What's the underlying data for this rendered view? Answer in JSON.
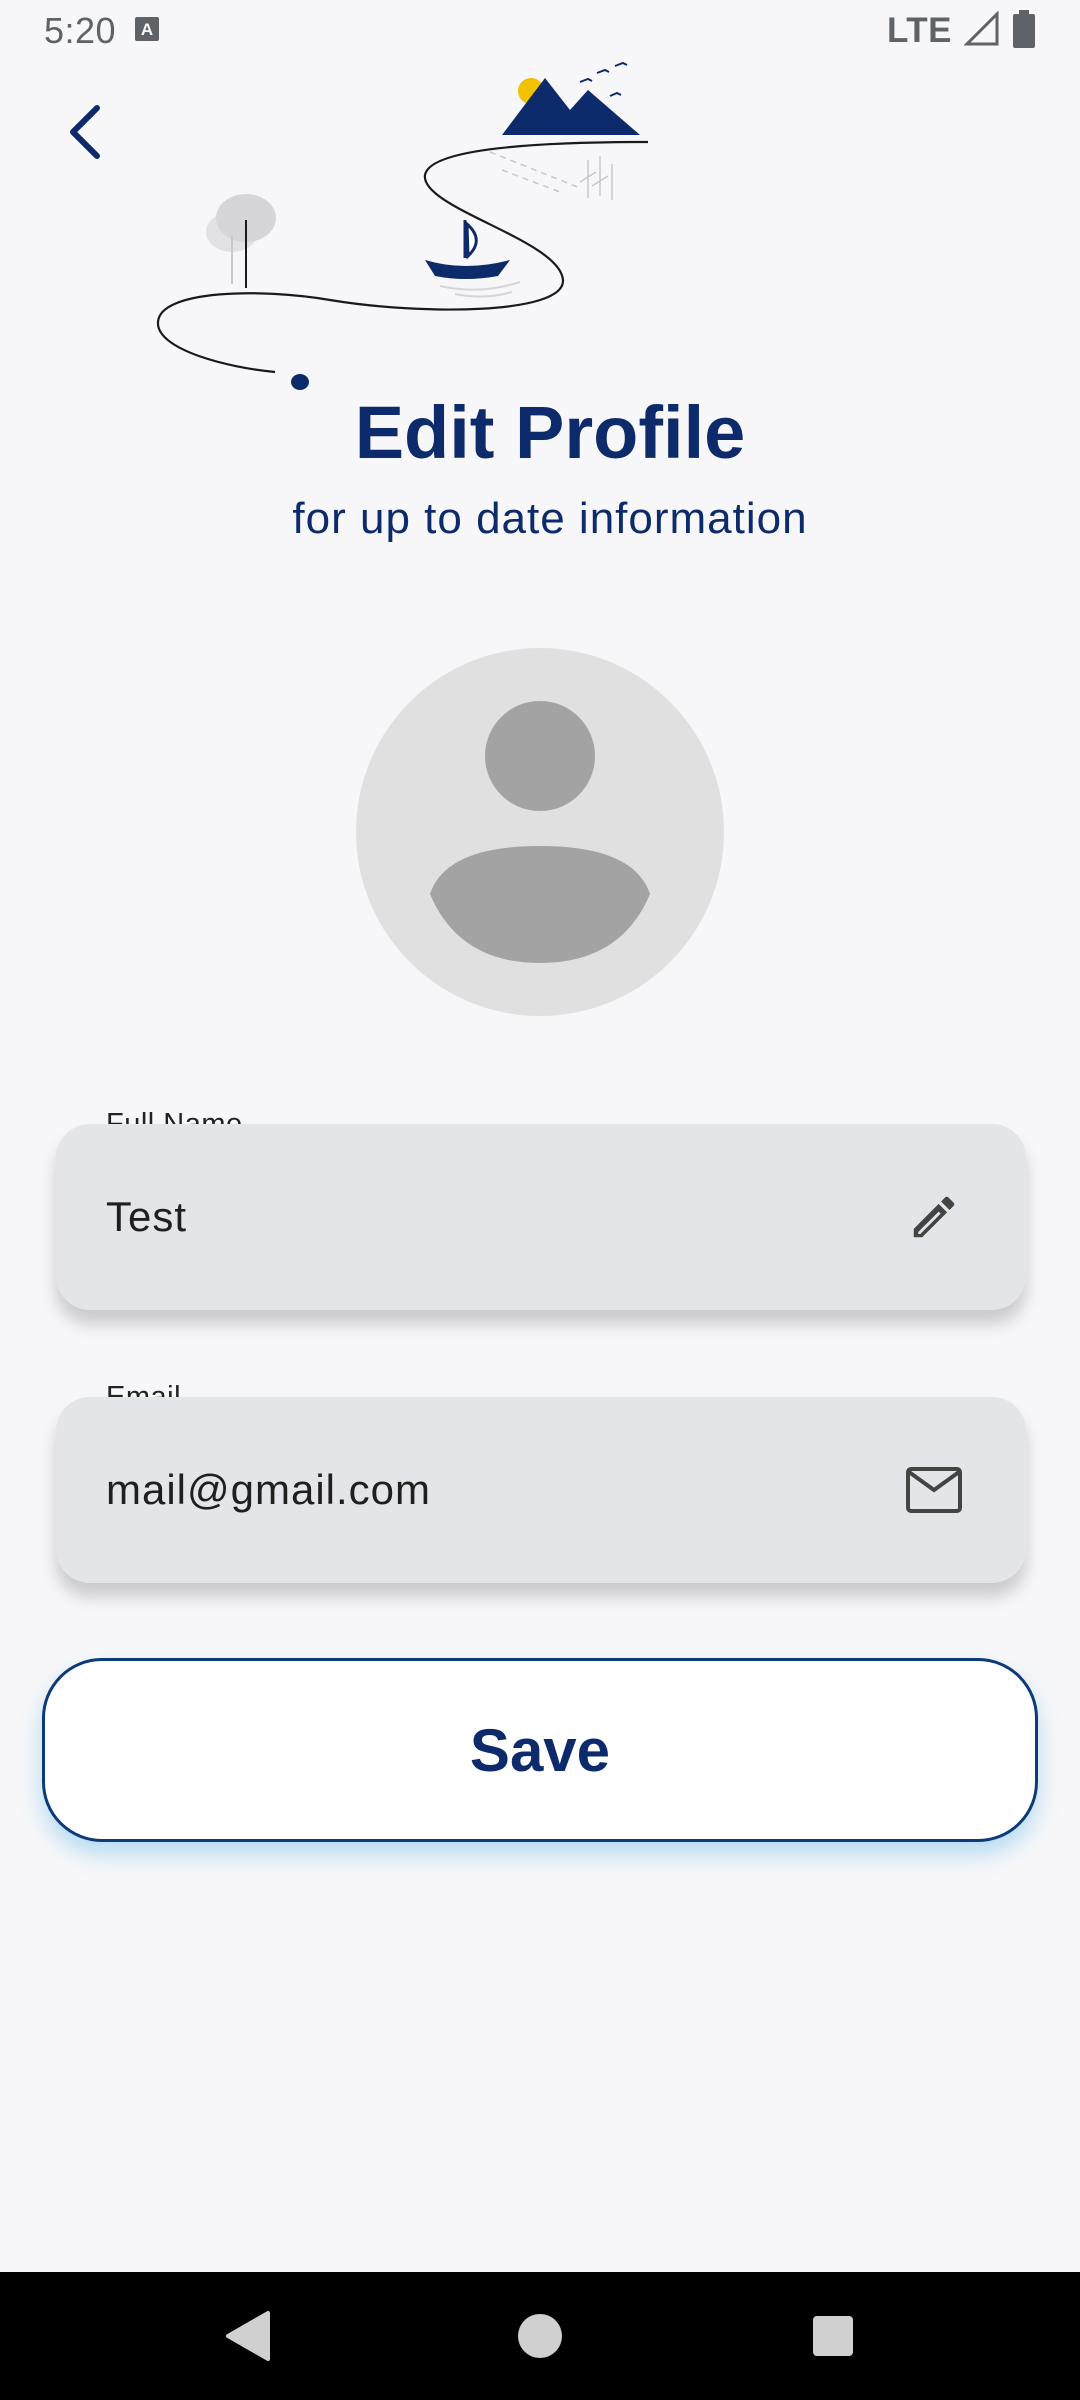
{
  "status_bar": {
    "time": "5:20",
    "network": "LTE",
    "icons": [
      "keyboard-icon",
      "signal-icon",
      "battery-icon"
    ]
  },
  "header": {
    "title": "Edit Profile",
    "subtitle": "for up to date information"
  },
  "form": {
    "full_name": {
      "label": "Full Name",
      "value": "Test",
      "icon": "pencil-icon"
    },
    "email": {
      "label": "Email",
      "value": "mail@gmail.com",
      "icon": "mail-icon"
    }
  },
  "actions": {
    "save_label": "Save"
  },
  "colors": {
    "primary": "#0d2b6b",
    "background": "#f7f7f9",
    "field_bg": "#e4e5e9",
    "accent_sun": "#f2c200"
  },
  "nav": {
    "icons": [
      "back-triangle-icon",
      "home-circle-icon",
      "recents-square-icon"
    ]
  }
}
